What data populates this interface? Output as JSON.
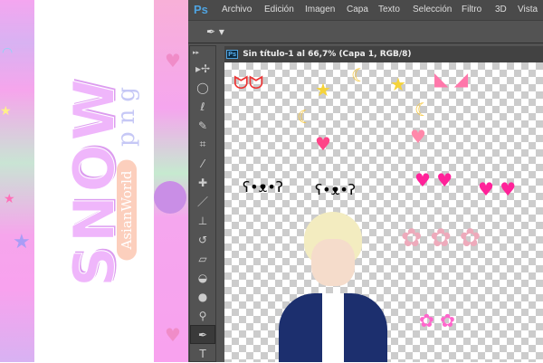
{
  "banner": {
    "title": "SNOW",
    "subtitle": "png",
    "brand": "AsianWorld"
  },
  "photoshop": {
    "logo": "Ps",
    "menu": [
      "Archivo",
      "Edición",
      "Imagen",
      "Capa",
      "Texto",
      "Selección",
      "Filtro",
      "3D",
      "Vista"
    ],
    "document_tab": "Sin título-1 al 66,7% (Capa 1, RGB/8)",
    "active_tool": "pen-tool",
    "tools": [
      "move",
      "marquee",
      "lasso",
      "quick-select",
      "crop",
      "eyedropper",
      "healing",
      "brush",
      "stamp",
      "history-brush",
      "eraser",
      "paint-bucket",
      "blur",
      "dodge",
      "pen",
      "type"
    ]
  },
  "colors": {
    "pink": "#f6a5ec",
    "ps_bg": "#535353",
    "accent": "#4fa3e0"
  }
}
